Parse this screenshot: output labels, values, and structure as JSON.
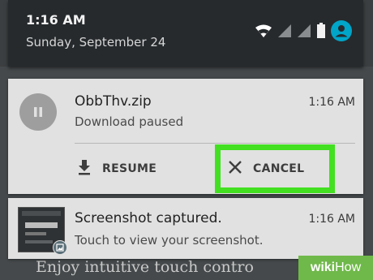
{
  "status_bar": {
    "time": "1:16 AM",
    "date": "Sunday, September 24",
    "icons": [
      "wifi-icon",
      "signal-icon",
      "signal-icon",
      "battery-icon",
      "account-icon"
    ]
  },
  "notifications": [
    {
      "icon": "pause-icon",
      "title": "ObbThv.zip",
      "subtitle": "Download paused",
      "time": "1:16 AM",
      "actions": [
        {
          "icon": "download-icon",
          "label": "RESUME"
        },
        {
          "icon": "close-icon",
          "label": "CANCEL"
        }
      ]
    },
    {
      "icon": "image-icon",
      "title": "Screenshot captured.",
      "subtitle": "Touch to view your screenshot.",
      "time": "1:16 AM"
    }
  ],
  "background_text": "Enjoy intuitive touch contro",
  "watermark": {
    "part1": "wiki",
    "part2": "How"
  },
  "colors": {
    "highlight": "#42e021",
    "card": "#e1e1e1",
    "header": "#262a2d",
    "accent": "#00a5c8"
  }
}
